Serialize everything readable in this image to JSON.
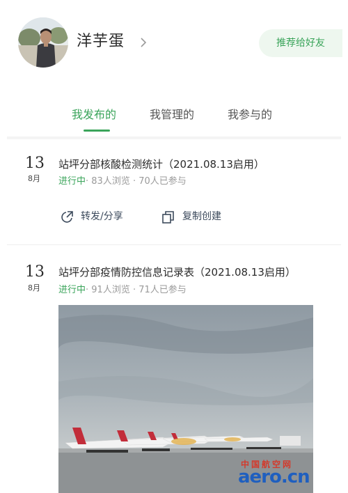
{
  "profile": {
    "name": "洋芋蛋",
    "recommend_label": "推荐给好友"
  },
  "tabs": [
    {
      "label": "我发布的",
      "active": true
    },
    {
      "label": "我管理的",
      "active": false
    },
    {
      "label": "我参与的",
      "active": false
    }
  ],
  "cards": [
    {
      "day": "13",
      "month": "8月",
      "title": "站坪分部核酸检测统计（2021.08.13启用）",
      "status": "进行中",
      "views": "· 83人浏览",
      "participants": "· 70人已参与",
      "actions": {
        "share": "转发/分享",
        "copy": "复制创建"
      }
    },
    {
      "day": "13",
      "month": "8月",
      "title": "站坪分部疫情防控信息记录表（2021.08.13启用）",
      "status": "进行中",
      "views": "· 91人浏览",
      "participants": "· 71人已参与"
    }
  ],
  "watermark": {
    "top": "中国航空网",
    "main": "aero.cn"
  },
  "colors": {
    "accent": "#3aa45a",
    "accent_bg": "#eef7ef"
  },
  "icons": [
    "chevron-right-icon",
    "share-icon",
    "copy-icon"
  ]
}
